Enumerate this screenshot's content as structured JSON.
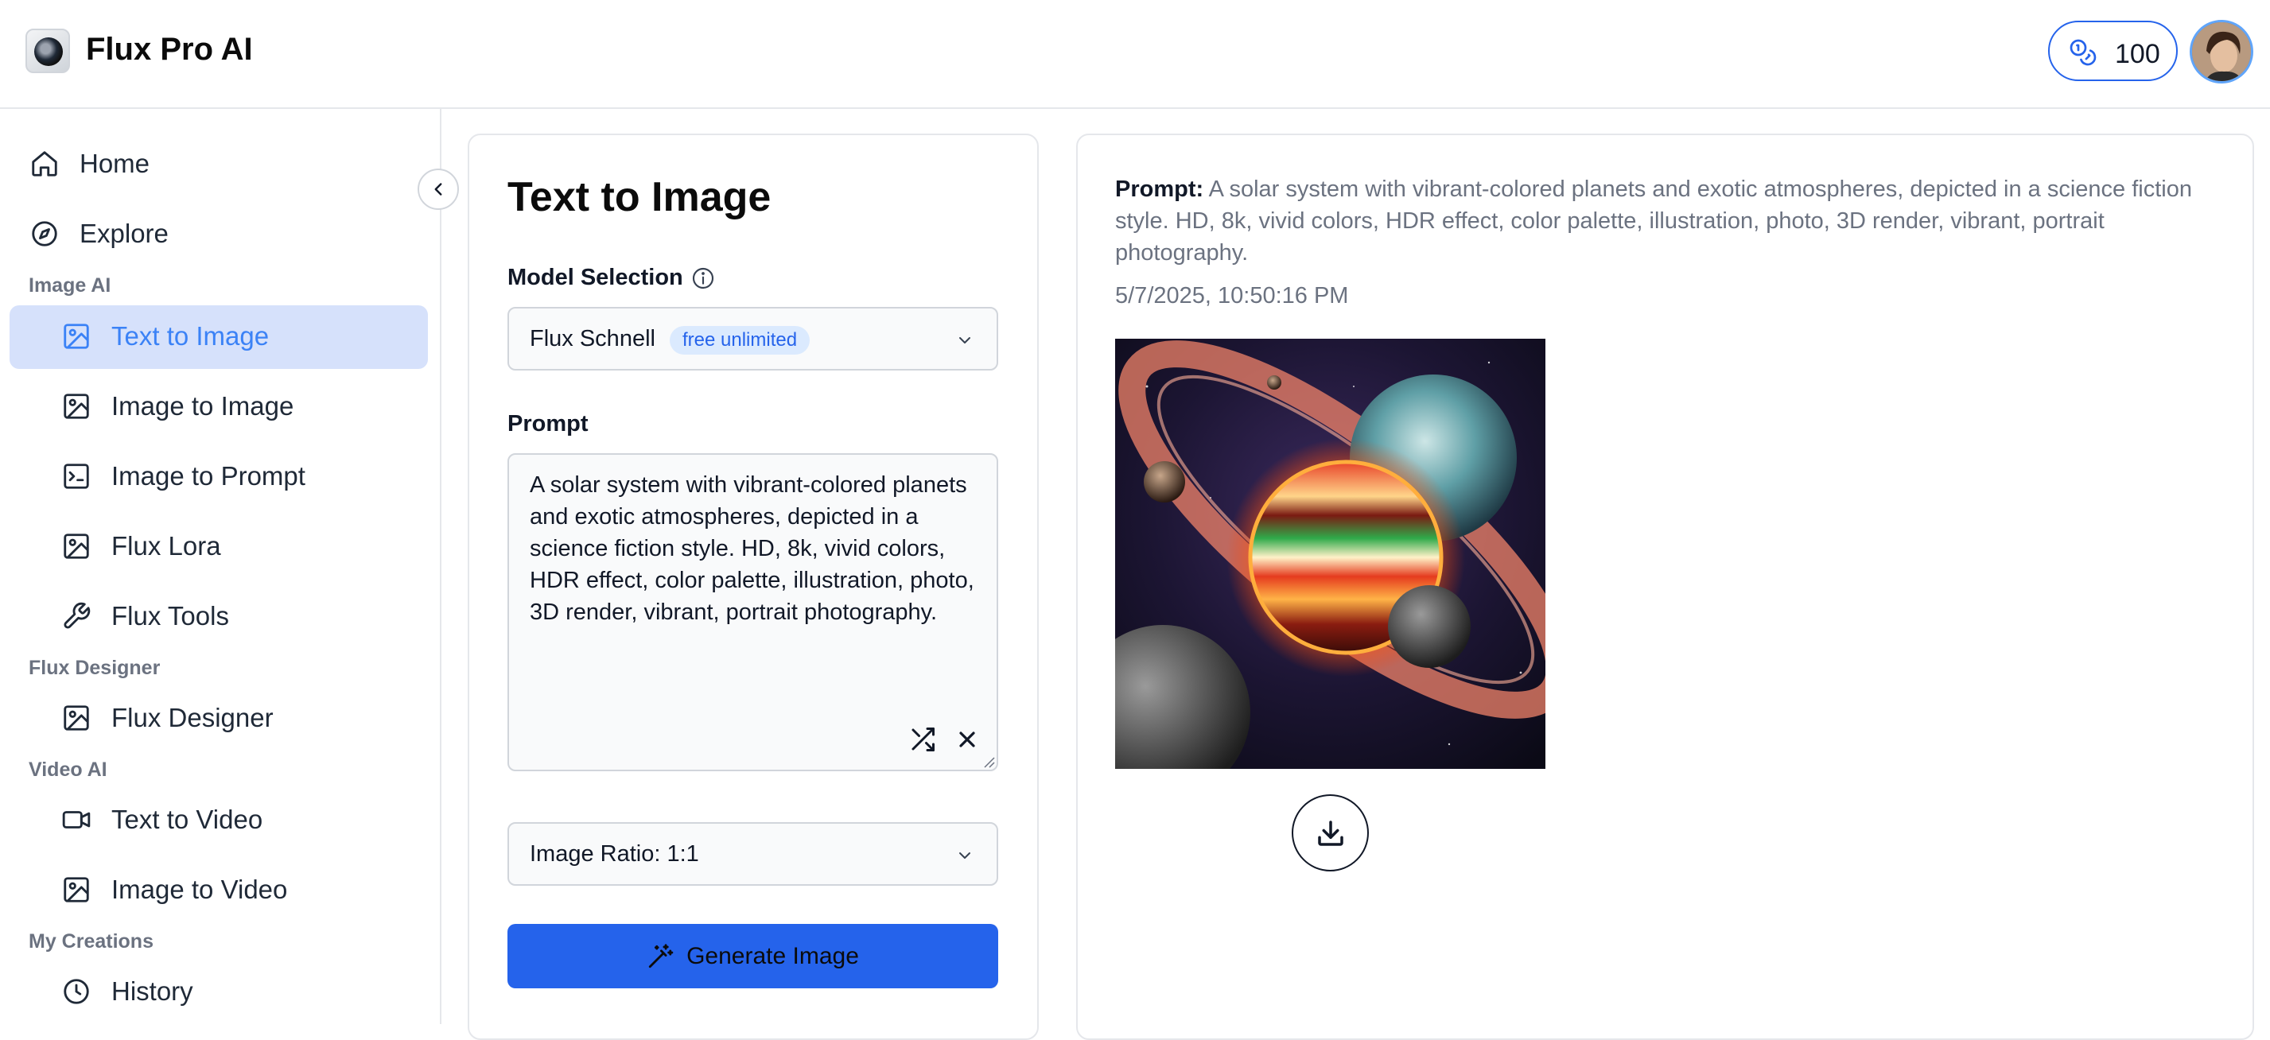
{
  "header": {
    "brand": "Flux Pro AI",
    "credits": "100"
  },
  "sidebar": {
    "items_top": [
      {
        "label": "Home",
        "icon": "home-icon"
      },
      {
        "label": "Explore",
        "icon": "compass-icon"
      }
    ],
    "sections": [
      {
        "label": "Image AI",
        "items": [
          {
            "label": "Text to Image",
            "icon": "image-icon",
            "active": true
          },
          {
            "label": "Image to Image",
            "icon": "image-icon"
          },
          {
            "label": "Image to Prompt",
            "icon": "terminal-icon"
          },
          {
            "label": "Flux Lora",
            "icon": "image-icon"
          },
          {
            "label": "Flux Tools",
            "icon": "wrench-icon"
          }
        ]
      },
      {
        "label": "Flux Designer",
        "items": [
          {
            "label": "Flux Designer",
            "icon": "image-icon"
          }
        ]
      },
      {
        "label": "Video AI",
        "items": [
          {
            "label": "Text to Video",
            "icon": "video-icon"
          },
          {
            "label": "Image to Video",
            "icon": "image-icon"
          }
        ]
      },
      {
        "label": "My Creations",
        "items": [
          {
            "label": "History",
            "icon": "clock-icon"
          }
        ]
      }
    ]
  },
  "form": {
    "title": "Text to Image",
    "model_label": "Model Selection",
    "model_value": "Flux Schnell",
    "model_badge": "free unlimited",
    "prompt_label": "Prompt",
    "prompt_value": "A solar system with vibrant-colored planets and exotic atmospheres, depicted in a science fiction style. HD, 8k, vivid colors, HDR effect, color palette, illustration, photo, 3D render, vibrant, portrait photography.",
    "ratio_value": "Image Ratio: 1:1",
    "generate_label": "Generate Image"
  },
  "result": {
    "prompt_label": "Prompt:",
    "prompt_text": "A solar system with vibrant-colored planets and exotic atmospheres, depicted in a science fiction style. HD, 8k, vivid colors, HDR effect, color palette, illustration, photo, 3D render, vibrant, portrait photography.",
    "timestamp": "5/7/2025, 10:50:16 PM"
  },
  "colors": {
    "accent": "#2563eb",
    "active_bg": "#d6e1fb",
    "active_text": "#3b82f6",
    "badge_bg": "#dbeafe"
  }
}
